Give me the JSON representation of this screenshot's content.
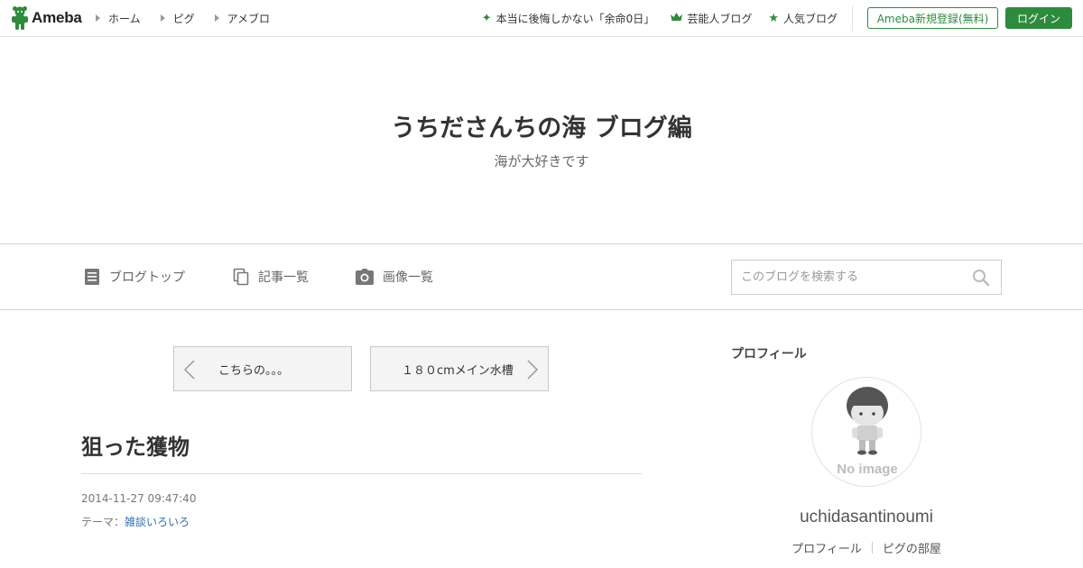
{
  "header": {
    "logo_text": "Ameba",
    "nav_left": [
      {
        "label": "ホーム"
      },
      {
        "label": "ピグ"
      },
      {
        "label": "アメブロ"
      }
    ],
    "nav_right": [
      {
        "label": "本当に後悔しかない「余命0日」",
        "icon": "sparkle-icon"
      },
      {
        "label": "芸能人ブログ",
        "icon": "crown-icon"
      },
      {
        "label": "人気ブログ",
        "icon": "star-icon"
      }
    ],
    "register_label": "Ameba新規登録(無料)",
    "login_label": "ログイン"
  },
  "blog": {
    "title": "うちださんちの海 ブログ編",
    "subtitle": "海が大好きです"
  },
  "blog_nav": {
    "items": [
      {
        "label": "ブログトップ",
        "icon": "document-icon"
      },
      {
        "label": "記事一覧",
        "icon": "pages-icon"
      },
      {
        "label": "画像一覧",
        "icon": "camera-icon"
      }
    ],
    "search_placeholder": "このブログを検索する"
  },
  "pager": {
    "prev_label": "こちらの。。。",
    "next_label": "１８０cmメイン水槽"
  },
  "article": {
    "title": "狙った獲物",
    "date": "2014-11-27 09:47:40",
    "theme_prefix": "テーマ：",
    "theme_link": "雑談いろいろ"
  },
  "sidebar": {
    "heading": "プロフィール",
    "avatar_text": "No image",
    "username": "uchidasantinoumi",
    "links": [
      {
        "label": "プロフィール"
      },
      {
        "label": "ピグの部屋"
      }
    ]
  },
  "colors": {
    "brand_green": "#2d8c3c",
    "link_blue": "#2e6fb5"
  }
}
